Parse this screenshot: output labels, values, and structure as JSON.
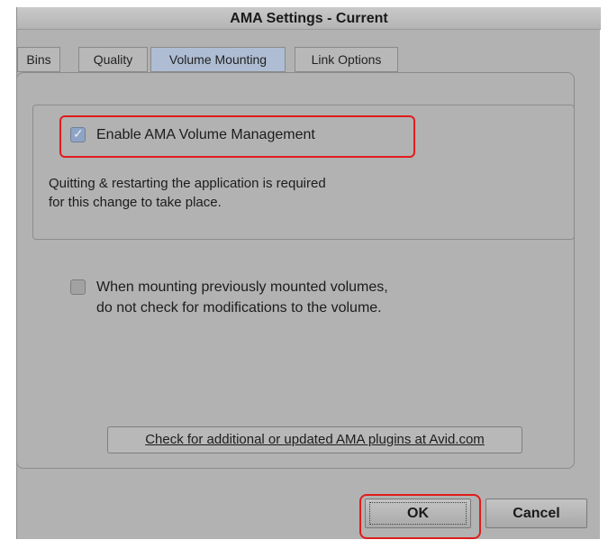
{
  "window": {
    "title": "AMA Settings - Current"
  },
  "tabs": [
    {
      "label": "Bins",
      "active": false
    },
    {
      "label": "Quality",
      "active": false
    },
    {
      "label": "Volume Mounting",
      "active": true
    },
    {
      "label": "Link Options",
      "active": false
    }
  ],
  "volume_management": {
    "checkbox_label": "Enable AMA Volume Management",
    "checked": true,
    "note_line1": "Quitting & restarting the application is required",
    "note_line2": "for this change to take place."
  },
  "mounting_option": {
    "label_line1": "When mounting previously mounted volumes,",
    "label_line2": "do not check for modifications to the volume.",
    "checked": false
  },
  "plugins_link": {
    "label": "Check for additional or updated AMA plugins at Avid.com"
  },
  "buttons": {
    "ok": "OK",
    "cancel": "Cancel"
  },
  "colors": {
    "highlight": "#e11b1b",
    "active_tab": "#aebdd3"
  }
}
